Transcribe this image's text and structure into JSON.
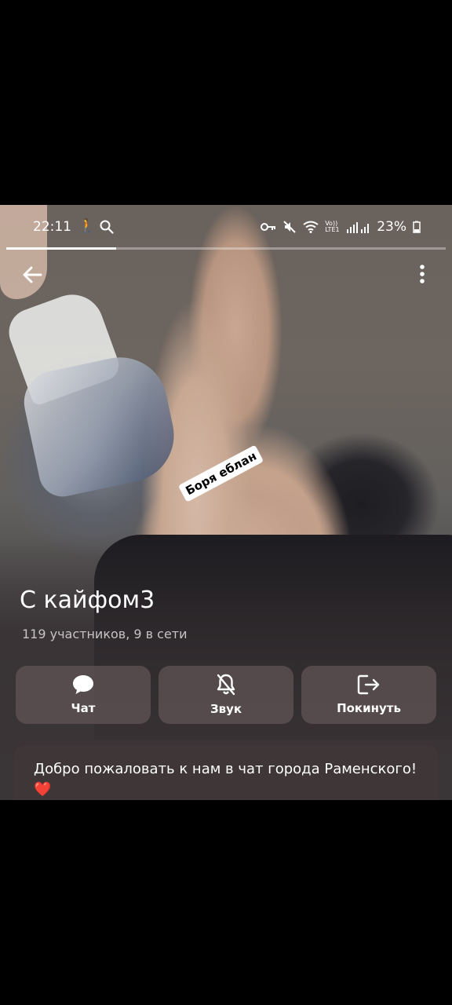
{
  "status_bar": {
    "time": "22:11",
    "network_label": "Vo)) LTE1",
    "battery": "23%",
    "story_progress": 0.25
  },
  "icons": {
    "back": "arrow-left-icon",
    "more": "more-vertical-icon",
    "chat": "speech-bubble-icon",
    "sound": "bell-off-icon",
    "leave": "logout-icon"
  },
  "photo": {
    "sticker_text": "Боря еблан"
  },
  "chat": {
    "title": "С кайфом3",
    "subtitle": "119 участников, 9 в сети"
  },
  "actions": {
    "chat_label": "Чат",
    "sound_label": "Звук",
    "leave_label": "Покинуть"
  },
  "description": {
    "text": "Добро пожаловать к нам в чат города Раменского!",
    "emoji": "❤️"
  },
  "colors": {
    "card_background": "#3e3637",
    "button_background": "#605456",
    "heart": "#e0232a"
  }
}
